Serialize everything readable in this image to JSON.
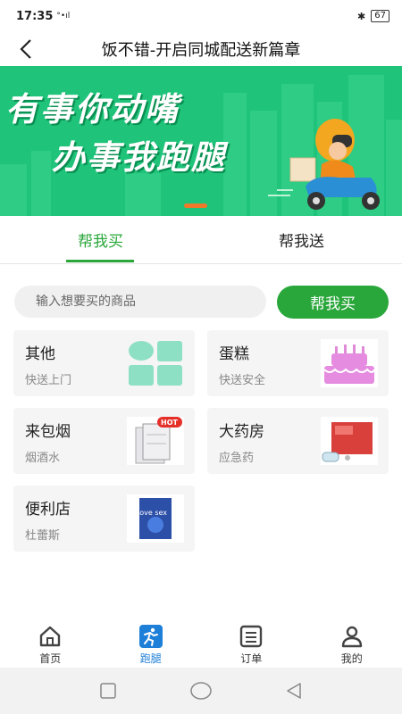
{
  "status": {
    "time": "17:35",
    "signal": "°•ıl",
    "battery": "67"
  },
  "header": {
    "title": "饭不错-开启同城配送新篇章"
  },
  "banner": {
    "line1": "有事你动嘴",
    "line2": "办事我跑腿"
  },
  "tabs": [
    {
      "label": "帮我买"
    },
    {
      "label": "帮我送"
    }
  ],
  "search": {
    "placeholder": "输入想要买的商品",
    "button_label": "帮我买"
  },
  "categories": [
    {
      "title": "其他",
      "subtitle": "快送上门"
    },
    {
      "title": "蛋糕",
      "subtitle": "快送安全"
    },
    {
      "title": "来包烟",
      "subtitle": "烟酒水",
      "badge": "HOT"
    },
    {
      "title": "大药房",
      "subtitle": "应急药"
    },
    {
      "title": "便利店",
      "subtitle": "杜蕾斯",
      "product_text": "Love sex"
    }
  ],
  "bottom_nav": [
    {
      "label": "首页"
    },
    {
      "label": "跑腿"
    },
    {
      "label": "订单"
    },
    {
      "label": "我的"
    }
  ],
  "colors": {
    "accent": "#2aa73b",
    "banner": "#1fc37a",
    "nav_active": "#1e7fd8"
  }
}
